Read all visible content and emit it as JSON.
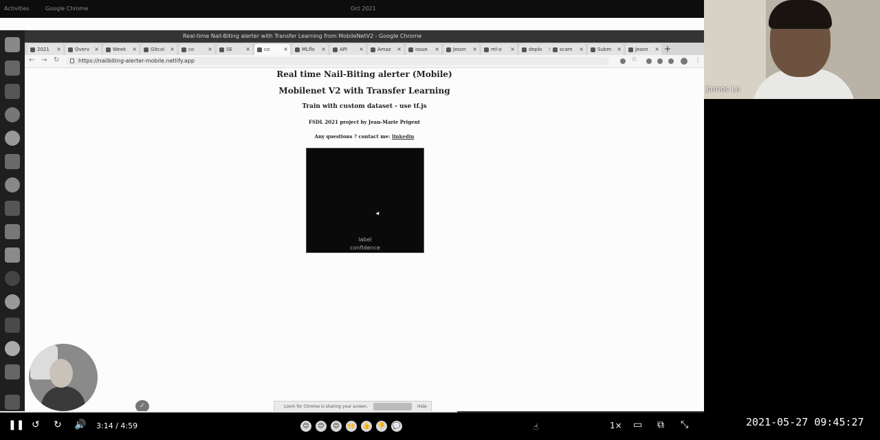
{
  "system_bar": {
    "activities": "Activities",
    "app": "Google Chrome",
    "clock": "Oct 2021"
  },
  "chrome": {
    "window_title": "Real-time Nail-Biting alerter with Transfer Learning from MobileNetV2 - Google Chrome",
    "tabs": [
      {
        "label": "2021"
      },
      {
        "label": "Overv"
      },
      {
        "label": "Week"
      },
      {
        "label": "Gitcoi"
      },
      {
        "label": "co"
      },
      {
        "label": "SE"
      },
      {
        "label": "co"
      },
      {
        "label": "MLflo"
      },
      {
        "label": "API"
      },
      {
        "label": "Amaz"
      },
      {
        "label": "issue"
      },
      {
        "label": "Jeson"
      },
      {
        "label": "ml-o"
      },
      {
        "label": "deplo"
      },
      {
        "label": "scam"
      },
      {
        "label": "Subm"
      },
      {
        "label": "Jeson"
      }
    ],
    "url": "https://nailbiting-alerter-mobile.netlify.app"
  },
  "page": {
    "title": "Real time Nail-Biting alerter (Mobile)",
    "subtitle": "Mobilenet V2 with Transfer Learning",
    "train_line": "Train with custom dataset - use tf.js",
    "project_line": "FSDL 2021 project by Jean-Marie Prigent",
    "contact_prefix": "Any questions ? contact me: ",
    "contact_link": "linkedin",
    "video_label": "label",
    "video_confidence": "confidence"
  },
  "share_bar": {
    "message": "Loom for Chrome is sharing your screen.",
    "hide": "Hide"
  },
  "participant": {
    "name": "James Le"
  },
  "player": {
    "current_time": "3:14",
    "duration": "4:59",
    "progress": 0.649,
    "speed": "1×",
    "reactions": [
      "😊",
      "😊",
      "😊",
      "🙌",
      "👍",
      "👎",
      "💬"
    ]
  },
  "timestamp": "2021-05-27  09:45:27",
  "colors": {
    "page_bg": "#fdfcfd",
    "video_bg": "#0a0a0a"
  }
}
